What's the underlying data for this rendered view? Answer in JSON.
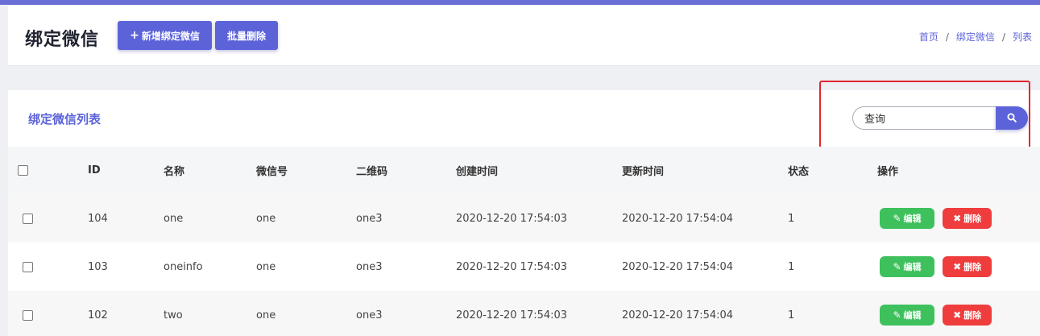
{
  "header": {
    "title": "绑定微信",
    "add_button": "新增绑定微信",
    "batch_delete_button": "批量删除",
    "breadcrumb": [
      "首页",
      "绑定微信",
      "列表"
    ]
  },
  "list": {
    "title": "绑定微信列表",
    "search_value": "查询",
    "columns": [
      "ID",
      "名称",
      "微信号",
      "二维码",
      "创建时间",
      "更新时间",
      "状态",
      "操作"
    ],
    "rows": [
      {
        "id": "104",
        "name": "one",
        "wechat": "one",
        "qrcode": "one3",
        "created": "2020-12-20 17:54:03",
        "updated": "2020-12-20 17:54:04",
        "status": "1"
      },
      {
        "id": "103",
        "name": "oneinfo",
        "wechat": "one",
        "qrcode": "one3",
        "created": "2020-12-20 17:54:03",
        "updated": "2020-12-20 17:54:04",
        "status": "1"
      },
      {
        "id": "102",
        "name": "two",
        "wechat": "one",
        "qrcode": "one3",
        "created": "2020-12-20 17:54:03",
        "updated": "2020-12-20 17:54:04",
        "status": "1"
      }
    ],
    "edit_label": "编辑",
    "delete_label": "删除"
  },
  "icons": {
    "add": "plus-icon",
    "search": "search-icon",
    "edit": "edit-icon",
    "delete": "close-icon"
  },
  "colors": {
    "primary": "#5c63d9",
    "edit": "#3ec15d",
    "delete": "#ef3d3d",
    "highlight": "#e0262f"
  }
}
